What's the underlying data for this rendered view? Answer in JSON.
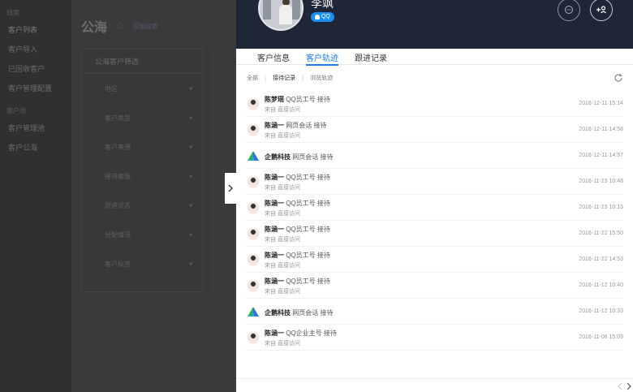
{
  "background": {
    "page_title": "公海",
    "page_link": "添加线索",
    "nav_sections": [
      {
        "title": "线索",
        "items": [
          "客户列表",
          "客户导入",
          "已回收客户",
          "客户管理配置"
        ]
      },
      {
        "title": "客户池",
        "items": [
          "客户管理池",
          "客户公海"
        ]
      }
    ],
    "filter_title": "公海客户筛选",
    "filters": [
      "地区",
      "客户类型",
      "客户来源",
      "接待客服",
      "跟进状态",
      "分配情况",
      "客户标签"
    ]
  },
  "customer": {
    "name": "李飒",
    "channel_badge": "QQ"
  },
  "tabs": [
    {
      "label": "客户信息",
      "active": false
    },
    {
      "label": "客户轨迹",
      "active": true
    },
    {
      "label": "跟进记录",
      "active": false
    }
  ],
  "subtabs": [
    {
      "label": "全部",
      "active": false
    },
    {
      "label": "接待记录",
      "active": true
    },
    {
      "label": "浏览轨迹",
      "active": false
    }
  ],
  "records": [
    {
      "avatar": "person",
      "who": "陈梦瑶",
      "detail": "QQ员工号 接待",
      "source": "来自 直接访问",
      "time": "2018-12-11 15:14"
    },
    {
      "avatar": "person",
      "who": "陈涵一",
      "detail": "网页会话 接待",
      "source": "来自 直接访问",
      "time": "2018-12-11 14:58"
    },
    {
      "avatar": "logo",
      "who": "企鹅科技",
      "detail": "网页会话 接待",
      "source": "",
      "time": "2018-12-11 14:57"
    },
    {
      "avatar": "person",
      "who": "陈涵一",
      "detail": "QQ员工号 接待",
      "source": "来自 直接访问",
      "time": "2018-11-23 10:48"
    },
    {
      "avatar": "person",
      "who": "陈涵一",
      "detail": "QQ员工号 接待",
      "source": "来自 直接访问",
      "time": "2018-11-23 10:13"
    },
    {
      "avatar": "person",
      "who": "陈涵一",
      "detail": "QQ员工号 接待",
      "source": "来自 直接访问",
      "time": "2018-11-22 15:50"
    },
    {
      "avatar": "person",
      "who": "陈涵一",
      "detail": "QQ员工号 接待",
      "source": "来自 直接访问",
      "time": "2018-11-22 14:53"
    },
    {
      "avatar": "person",
      "who": "陈涵一",
      "detail": "QQ员工号 接待",
      "source": "来自 直接访问",
      "time": "2018-11-12 10:40"
    },
    {
      "avatar": "logo",
      "who": "企鹅科技",
      "detail": "网页会话 接待",
      "source": "",
      "time": "2018-11-12 10:33"
    },
    {
      "avatar": "person",
      "who": "陈涵一",
      "detail": "QQ企业主号 接待",
      "source": "来自 直接访问",
      "time": "2018-11-06 15:09"
    }
  ],
  "colors": {
    "header_bg": "#1f2638",
    "accent": "#1a7be0",
    "badge": "#1b8ef3"
  },
  "icons": {
    "toggle": "chevron-right-icon",
    "chat": "chat-bubble-icon",
    "add": "add-user-icon",
    "refresh": "refresh-icon",
    "pager_prev": "chevron-left-icon",
    "pager_next": "chevron-right-icon"
  }
}
